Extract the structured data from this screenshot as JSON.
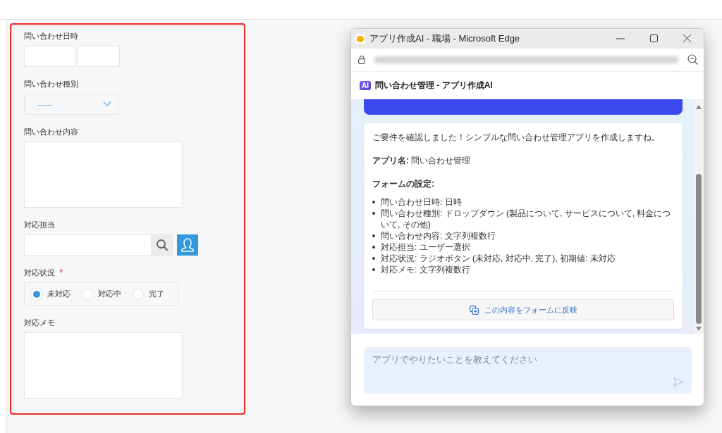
{
  "form": {
    "fields": [
      {
        "kind": "datetime",
        "label": "問い合わせ日時"
      },
      {
        "kind": "select",
        "label": "問い合わせ種別",
        "value": "------"
      },
      {
        "kind": "textarea",
        "label": "問い合わせ内容"
      },
      {
        "kind": "user",
        "label": "対応担当"
      },
      {
        "kind": "radio",
        "label": "対応状況",
        "required_mark": "*",
        "options": [
          {
            "label": "未対応",
            "selected": true
          },
          {
            "label": "対応中",
            "selected": false
          },
          {
            "label": "完了",
            "selected": false
          }
        ]
      },
      {
        "kind": "textarea",
        "label": "対応メモ"
      }
    ]
  },
  "browser": {
    "title": "アプリ作成AI - 職場 - Microsoft Edge",
    "app_badge": "AI",
    "page_title": "問い合わせ管理 - アプリ作成AI",
    "message": {
      "intro": "ご要件を確認しました！シンプルな問い合わせ管理アプリを作成しますね。",
      "app_name": "**アプリ名:** 問い合わせ管理",
      "settings_heading": "フォームの設定:",
      "items": [
        "問い合わせ日時: 日時",
        "問い合わせ種別: ドロップダウン (製品について, サービスについて, 料金について, その他)",
        "問い合わせ内容: 文字列複数行",
        "対応担当: ユーザー選択",
        "対応状況: ラジオボタン (未対応, 対応中, 完了), 初期値: 未対応",
        "対応メモ: 文字列複数行"
      ],
      "apply_button": "この内容をフォームに反映"
    },
    "input_placeholder": "アプリでやりたいことを教えてください"
  }
}
